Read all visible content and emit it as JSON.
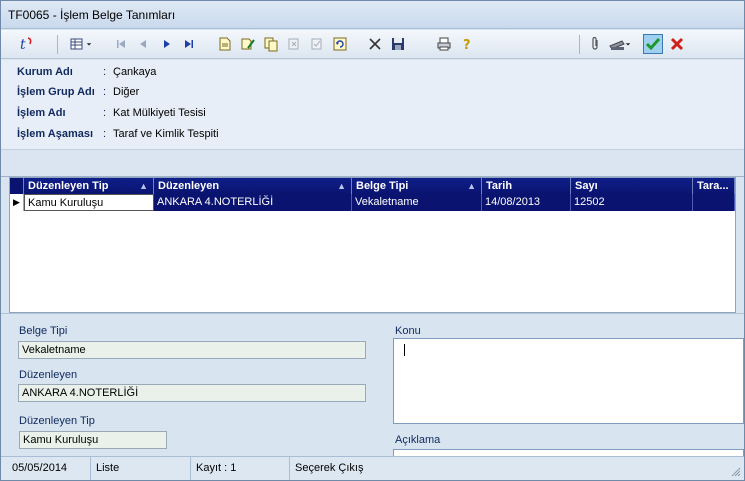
{
  "window": {
    "title": "TF0065 - İşlem Belge Tanımları"
  },
  "toolbar": {
    "icons": [
      "app-logo-icon",
      "grid-view-icon",
      "first-record-icon",
      "previous-record-icon",
      "next-record-icon",
      "last-record-icon",
      "new-record-icon",
      "edit-record-icon",
      "copy-record-icon",
      "delete-record-icon",
      "post-record-icon",
      "refresh-icon",
      "cancel-icon",
      "save-icon",
      "print-icon",
      "help-icon",
      "attachment-icon",
      "scanner-icon",
      "confirm-icon",
      "close-icon"
    ]
  },
  "info": [
    {
      "label": "Kurum Adı",
      "value": "Çankaya"
    },
    {
      "label": "İşlem Grup Adı",
      "value": "Diğer"
    },
    {
      "label": "İşlem Adı",
      "value": "Kat Mülkiyeti Tesisi"
    },
    {
      "label": "İşlem Aşaması",
      "value": "Taraf ve Kimlik Tespiti"
    }
  ],
  "info_colon": ":",
  "grid": {
    "columns": [
      "Düzenleyen Tip",
      "Düzenleyen",
      "Belge Tipi",
      "Tarih",
      "Sayı",
      "Tara..."
    ],
    "rows": [
      [
        "Kamu Kuruluşu",
        "ANKARA 4.NOTERLİĞİ",
        "Vekaletname",
        "14/08/2013",
        "12502",
        ""
      ]
    ],
    "row_indicator": "▶"
  },
  "detail": {
    "belge_tipi_label": "Belge Tipi",
    "belge_tipi_value": "Vekaletname",
    "duzenleyen_label": "Düzenleyen",
    "duzenleyen_value": "ANKARA 4.NOTERLİĞİ",
    "duzenleyen_tip_label": "Düzenleyen Tip",
    "duzenleyen_tip_value": "Kamu Kuruluşu",
    "konu_label": "Konu",
    "konu_value": "",
    "aciklama_label": "Açıklama"
  },
  "status": {
    "date": "05/05/2014",
    "mode": "Liste",
    "record": "Kayıt : 1",
    "hint": "Seçerek Çıkış"
  },
  "colors": {
    "grid_header": "#0a1470",
    "label_text": "#10295e",
    "confirm": "#1a9a2a",
    "close": "#d0201a"
  }
}
